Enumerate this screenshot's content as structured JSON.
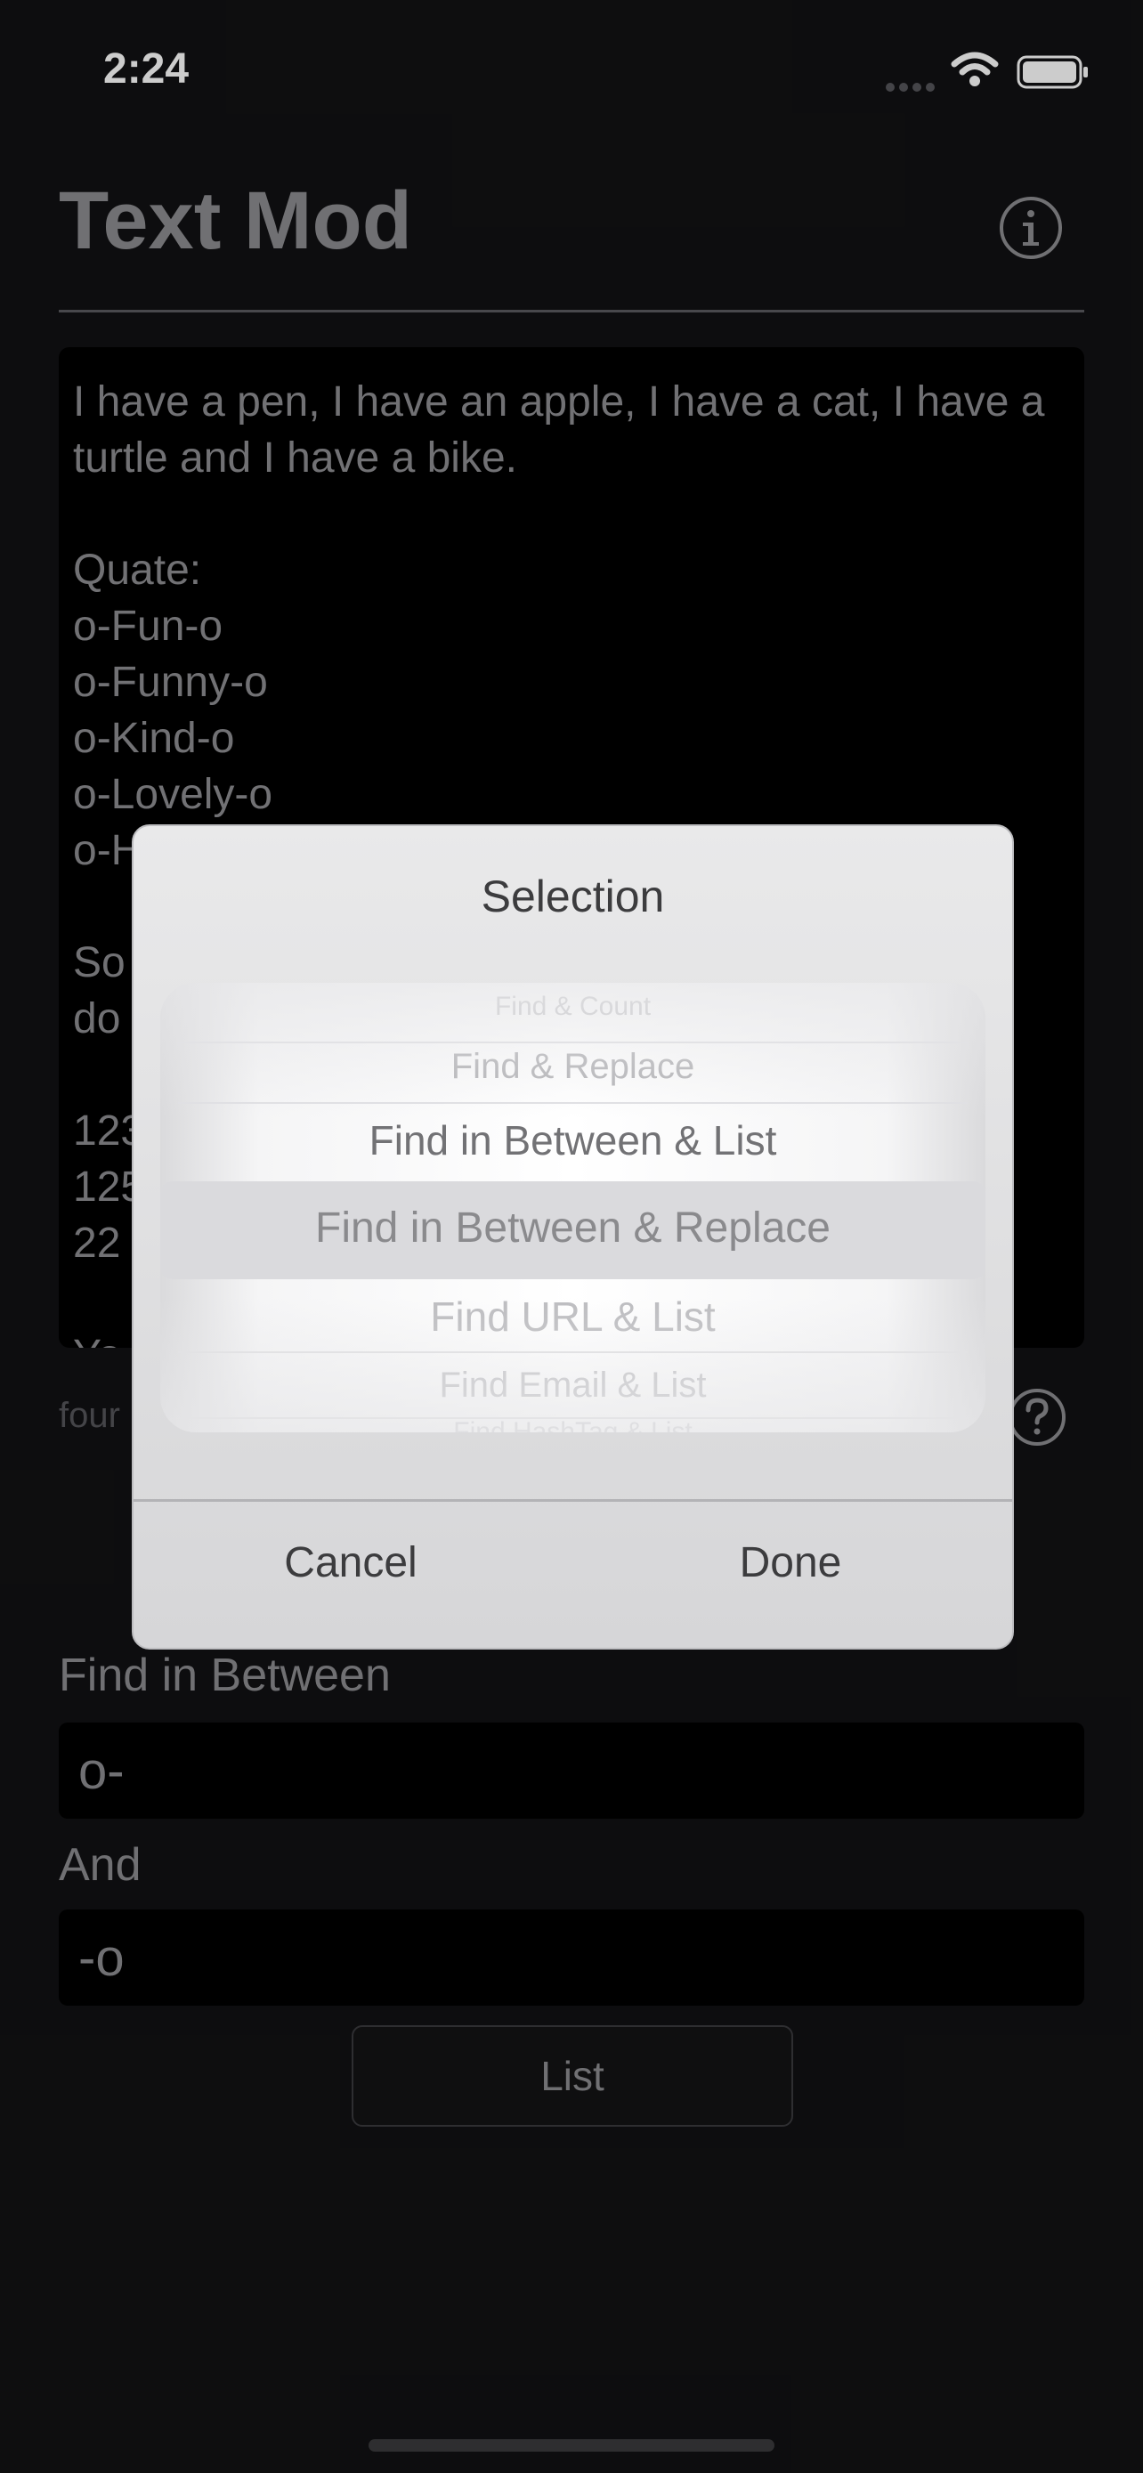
{
  "status_bar": {
    "time": "2:24",
    "icons": [
      "signal-dots-icon",
      "wifi-icon",
      "battery-icon"
    ]
  },
  "header": {
    "title": "Text Mod",
    "info_icon": "info-circle-icon"
  },
  "editor": {
    "text": "I have a pen, I have an apple, I have a cat, I have a turtle and I have a bike.\n\nQuate:\no-Fun-o\no-Funny-o\no-Kind-o\no-Lovely-o\no-H\n\nSo\ndo\n\n123\n125\n22\n\nYo"
  },
  "result": {
    "found_text": "four",
    "help_icon": "question-circle-icon"
  },
  "form": {
    "find_label": "Find in Between",
    "find_value": "o-",
    "and_label": "And",
    "and_value": "-o",
    "list_button": "List"
  },
  "dialog": {
    "title": "Selection",
    "options": [
      "Find & Count",
      "Find & Replace",
      "Find in Between & List",
      "Find in Between & Replace",
      "Find URL & List",
      "Find Email & List",
      "Find HashTag & List"
    ],
    "selected": "Find in Between & Replace",
    "cancel_label": "Cancel",
    "done_label": "Done"
  },
  "colors": {
    "background": "#111113",
    "dialog_background": "#e4e4e6",
    "muted_text": "#8d8d90"
  }
}
